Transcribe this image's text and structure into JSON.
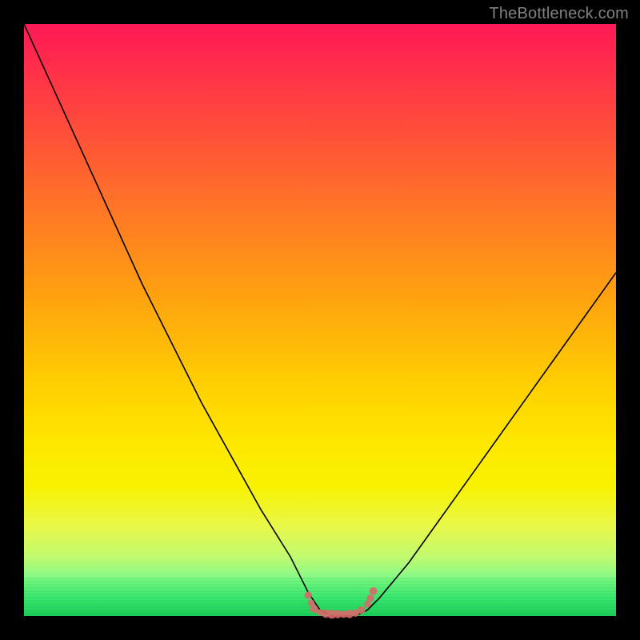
{
  "watermark": "TheBottleneck.com",
  "chart_data": {
    "type": "line",
    "title": "",
    "xlabel": "",
    "ylabel": "",
    "xlim": [
      0,
      100
    ],
    "ylim": [
      0,
      100
    ],
    "series": [
      {
        "name": "bottleneck-curve",
        "x": [
          0,
          5,
          10,
          15,
          20,
          25,
          30,
          35,
          40,
          45,
          48,
          50,
          52,
          54,
          56,
          58,
          60,
          65,
          70,
          75,
          80,
          85,
          90,
          95,
          100
        ],
        "y": [
          100,
          89,
          78,
          67,
          56,
          46,
          36,
          27,
          18,
          10,
          4,
          1,
          0,
          0,
          0,
          1,
          3,
          9,
          16,
          23,
          30,
          37,
          44,
          51,
          58
        ]
      }
    ],
    "markers": {
      "name": "highlight-points",
      "color": "#d86a6a",
      "x": [
        48,
        48.5,
        49,
        50,
        51,
        52,
        53,
        54,
        55,
        56,
        57,
        58,
        58.5,
        59
      ],
      "y": [
        3.5,
        2.2,
        1.2,
        0.6,
        0.4,
        0.3,
        0.3,
        0.3,
        0.35,
        0.5,
        1.0,
        2.0,
        3.0,
        4.2
      ]
    },
    "grid": false,
    "legend": false
  }
}
